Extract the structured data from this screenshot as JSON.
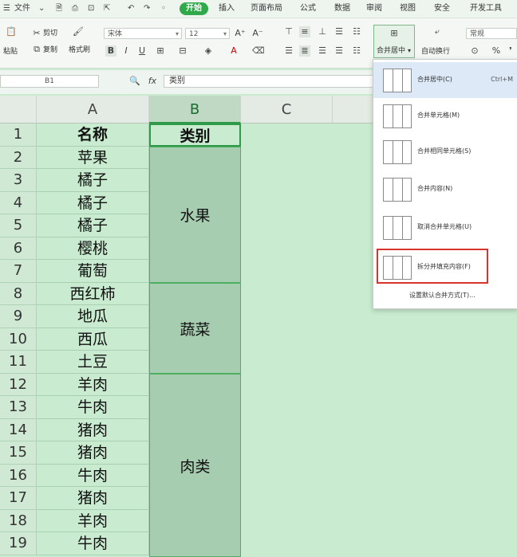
{
  "qat": {
    "file": "文件",
    "items": [
      "开始",
      "插入",
      "页面布局",
      "公式",
      "数据",
      "审阅",
      "视图",
      "安全",
      "开发工具"
    ]
  },
  "ribbon": {
    "paste": "粘贴",
    "cut": "剪切",
    "copy": "复制",
    "format_painter": "格式刷",
    "font_name": "宋体",
    "font_size": "12",
    "merge_center": "合并居中",
    "wrap": "自动换行",
    "number_format": "常规"
  },
  "formula_bar": {
    "name_box": "B1",
    "fx": "fx",
    "value": "类别"
  },
  "columns": [
    "A",
    "B",
    "C"
  ],
  "rows": [
    "1",
    "2",
    "3",
    "4",
    "5",
    "6",
    "7",
    "8",
    "9",
    "10",
    "11",
    "12",
    "13",
    "14",
    "15",
    "16",
    "17",
    "18",
    "19"
  ],
  "colA": [
    "名称",
    "苹果",
    "橘子",
    "橘子",
    "橘子",
    "樱桃",
    "葡萄",
    "西红柿",
    "地瓜",
    "西瓜",
    "土豆",
    "羊肉",
    "牛肉",
    "猪肉",
    "猪肉",
    "牛肉",
    "猪肉",
    "羊肉",
    "牛肉"
  ],
  "colB": {
    "header": "类别",
    "fruit": "水果",
    "veg": "蔬菜",
    "meat": "肉类"
  },
  "menu": {
    "items": [
      {
        "label": "合并居中(C)",
        "shortcut": "Ctrl+M"
      },
      {
        "label": "合并单元格(M)",
        "shortcut": ""
      },
      {
        "label": "合并相同单元格(S)",
        "shortcut": ""
      },
      {
        "label": "合并内容(N)",
        "shortcut": ""
      },
      {
        "label": "取消合并单元格(U)",
        "shortcut": ""
      },
      {
        "label": "拆分并填充内容(F)",
        "shortcut": ""
      }
    ],
    "settings": "设置默认合并方式(T)..."
  }
}
